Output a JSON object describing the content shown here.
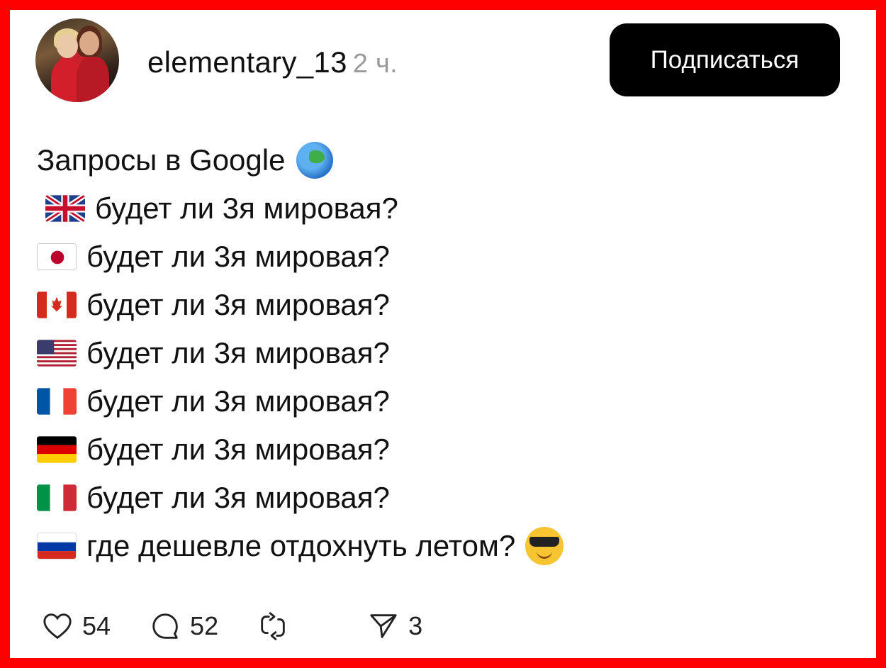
{
  "author": {
    "username": "elementary_13",
    "time": "2 ч."
  },
  "subscribe_label": "Подписаться",
  "post": {
    "title": "Запросы в Google",
    "lines": [
      {
        "flag": "uk-flag-icon",
        "text": "будет ли 3я мировая?"
      },
      {
        "flag": "japan-flag-icon",
        "text": "будет ли 3я мировая?"
      },
      {
        "flag": "canada-flag-icon",
        "text": "будет ли 3я мировая?"
      },
      {
        "flag": "usa-flag-icon",
        "text": "будет ли 3я мировая?"
      },
      {
        "flag": "france-flag-icon",
        "text": "будет ли 3я мировая?"
      },
      {
        "flag": "germany-flag-icon",
        "text": "будет ли 3я мировая?"
      },
      {
        "flag": "italy-flag-icon",
        "text": "будет ли 3я мировая?"
      },
      {
        "flag": "russia-flag-icon",
        "text": "где дешевле отдохнуть летом?"
      }
    ]
  },
  "stats": {
    "likes": "54",
    "comments": "52",
    "shares": "3"
  },
  "colors": {
    "frame": "#ff0000",
    "button": "#000000",
    "time": "#9a9a9a"
  }
}
